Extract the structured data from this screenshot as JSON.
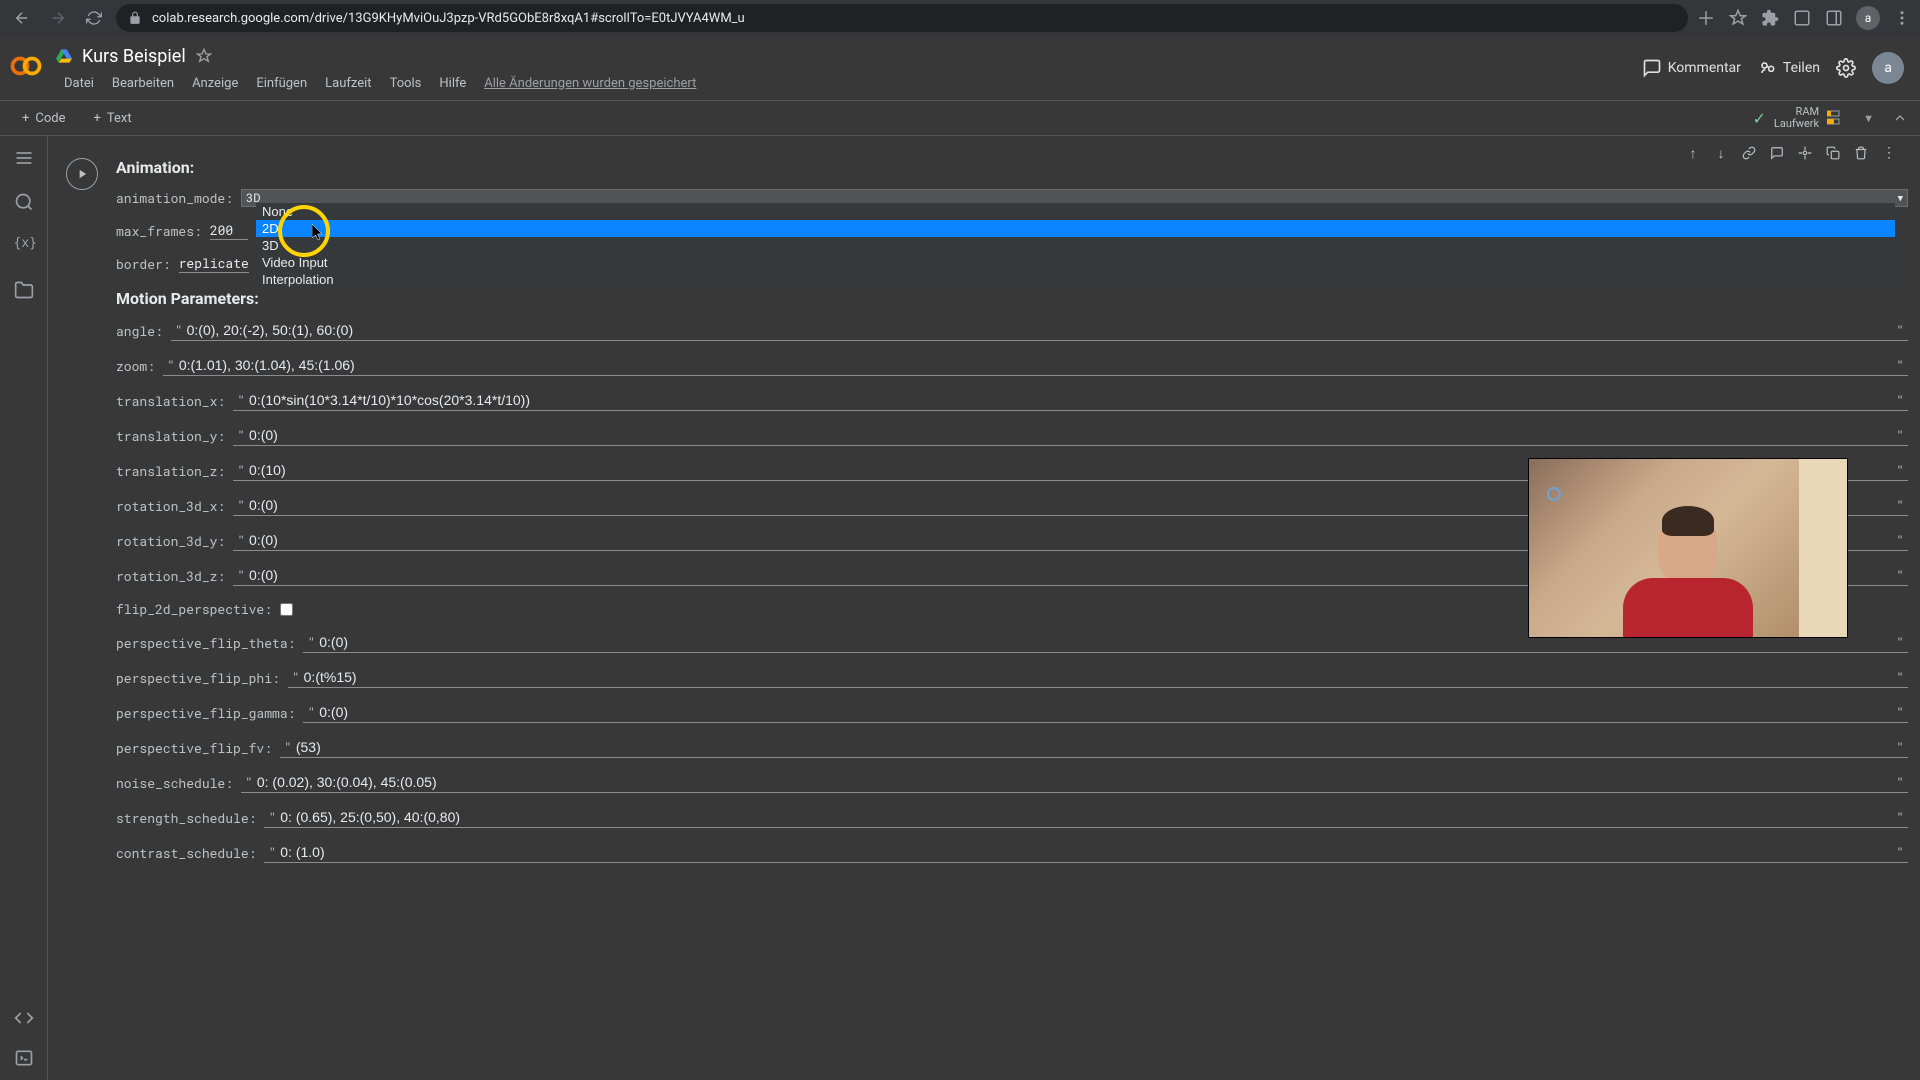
{
  "browser": {
    "url": "colab.research.google.com/drive/13G9KHyMviOuJ3pzp-VRd5GObE8r8xqA1#scrollTo=E0tJVYA4WM_u"
  },
  "header": {
    "title": "Kurs Beispiel",
    "menu": [
      "Datei",
      "Bearbeiten",
      "Anzeige",
      "Einfügen",
      "Laufzeit",
      "Tools",
      "Hilfe"
    ],
    "save_status": "Alle Änderungen wurden gespeichert",
    "comment": "Kommentar",
    "share": "Teilen",
    "avatar": "a"
  },
  "toolbar": {
    "code": "Code",
    "text": "Text",
    "ram": "RAM",
    "disk": "Laufwerk"
  },
  "dropdown": {
    "options": [
      "None",
      "2D",
      "3D",
      "Video Input",
      "Interpolation"
    ]
  },
  "form": {
    "section_animation": "Animation:",
    "section_motion": "Motion Parameters:",
    "labels": {
      "animation_mode": "animation_mode:",
      "max_frames": "max_frames:",
      "border": "border:",
      "angle": "angle:",
      "zoom": "zoom:",
      "translation_x": "translation_x:",
      "translation_y": "translation_y:",
      "translation_z": "translation_z:",
      "rotation_3d_x": "rotation_3d_x:",
      "rotation_3d_y": "rotation_3d_y:",
      "rotation_3d_z": "rotation_3d_z:",
      "flip_2d_perspective": "flip_2d_perspective:",
      "perspective_flip_theta": "perspective_flip_theta:",
      "perspective_flip_phi": "perspective_flip_phi:",
      "perspective_flip_gamma": "perspective_flip_gamma:",
      "perspective_flip_fv": "perspective_flip_fv:",
      "noise_schedule": "noise_schedule:",
      "strength_schedule": "strength_schedule:",
      "contrast_schedule": "contrast_schedule:"
    },
    "values": {
      "animation_mode": "3D",
      "max_frames": "200",
      "border": "replicate",
      "angle": "0:(0), 20:(-2), 50:(1), 60:(0)",
      "zoom": "0:(1.01), 30:(1.04), 45:(1.06)",
      "translation_x": "0:(10*sin(10*3.14*t/10)*10*cos(20*3.14*t/10))",
      "translation_y": "0:(0)",
      "translation_z": "0:(10)",
      "rotation_3d_x": "0:(0)",
      "rotation_3d_y": "0:(0)",
      "rotation_3d_z": "0:(0)",
      "perspective_flip_theta": "0:(0)",
      "perspective_flip_phi": "0:(t%15)",
      "perspective_flip_gamma": "0:(0)",
      "perspective_flip_fv": "(53)",
      "noise_schedule": "0: (0.02), 30:(0.04), 45:(0.05)",
      "strength_schedule": "0: (0.65), 25:(0,50), 40:(0,80)",
      "contrast_schedule": "0: (1.0)"
    }
  }
}
